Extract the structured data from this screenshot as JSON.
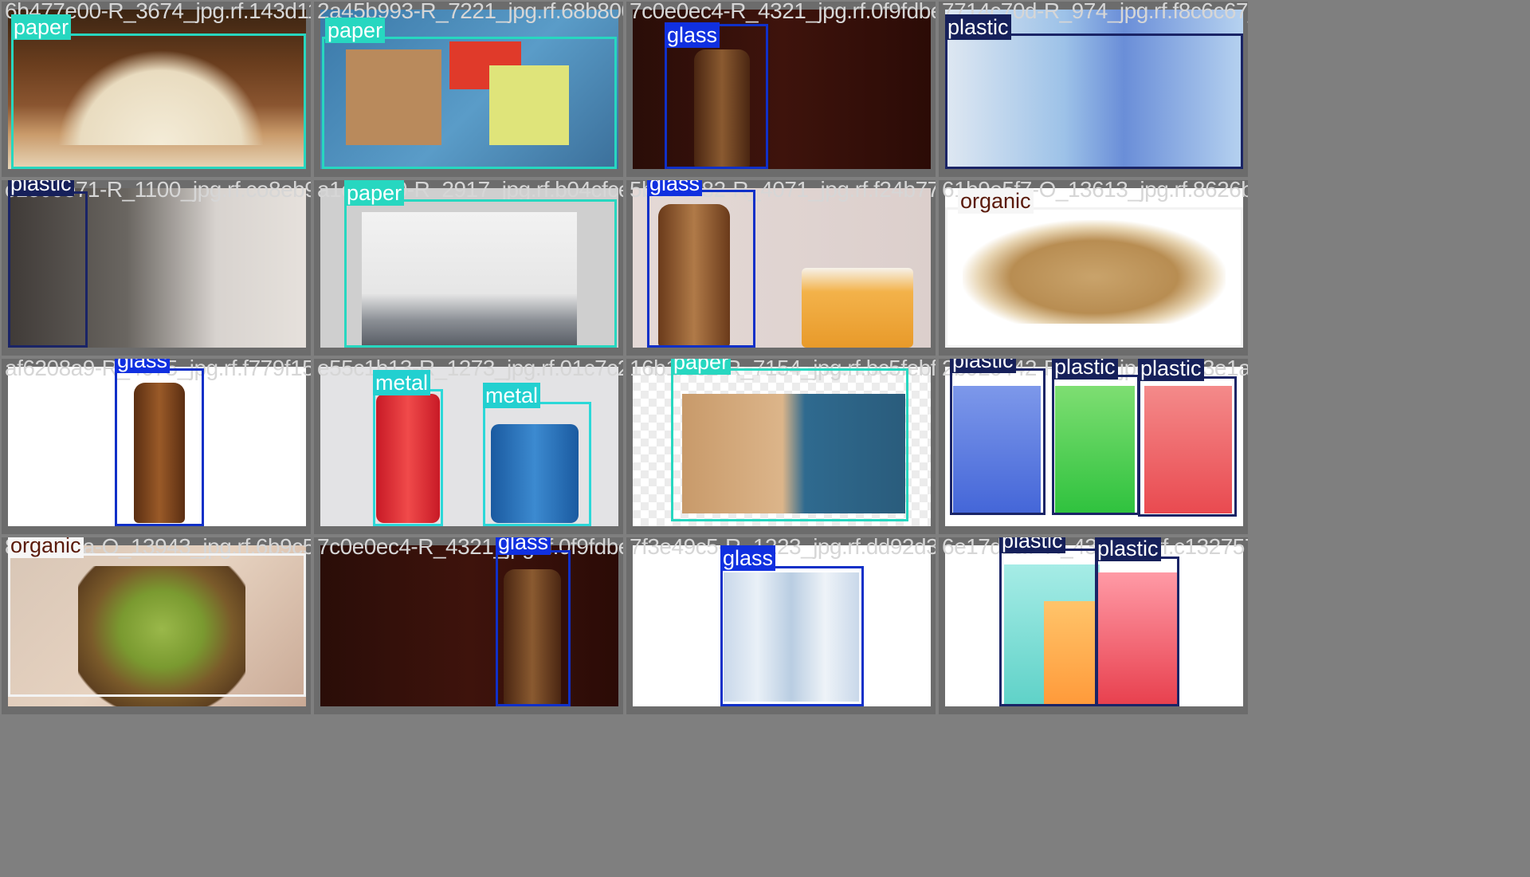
{
  "tiles": [
    {
      "filename": "6b477e00-R_3674_jpg.rf.143d112579c1a4fe0a9",
      "labels": [
        "paper"
      ]
    },
    {
      "filename": "2a45b993-R_7221_jpg.rf.68b80054a7d35a77",
      "labels": [
        "paper"
      ]
    },
    {
      "filename": "7c0e0ec4-R_4321_jpg.rf.0f9fdbe395bc",
      "labels": [
        "glass"
      ]
    },
    {
      "filename": "7714c70d-R_974_jpg.rf.f8c6c67_c7",
      "labels": [
        "plastic"
      ]
    },
    {
      "filename": "c1e09e71-R_1100_jpg.rf.co8eb9d5812c",
      "labels": [
        "plastic"
      ]
    },
    {
      "filename": "a1e9f4b0-R_2917_jpg.rf.b04cfced32ff",
      "labels": [
        "paper"
      ]
    },
    {
      "filename": "5b3d1a82-R_4071_jpg.rf.f24b7776996f",
      "labels": [
        "glass"
      ]
    },
    {
      "filename": "61b9e5f7-O_13613_jpg.rf.8626b075",
      "labels": [
        "organic"
      ]
    },
    {
      "filename": "af6208a9-R_4075_jpg.rf.f779f15933c056",
      "labels": [
        "glass"
      ]
    },
    {
      "filename": "e55c1b13-R_1273_jpg.rf.01c7c2fa19e13",
      "labels": [
        "metal",
        "metal"
      ]
    },
    {
      "filename": "16b1f3c2-R_7154_jpg.rf.bc5febfaed2bb",
      "labels": [
        "paper"
      ]
    },
    {
      "filename": "2b92c442-R_880_jpg.rf.f0a3e1a7d55",
      "labels": [
        "plastic",
        "plastic",
        "plastic"
      ]
    },
    {
      "filename": "8f1b393a-O_13943_jpg.rf.6b9c5efd8c35",
      "labels": [
        "organic"
      ]
    },
    {
      "filename": "7c0e0ec4-R_4321_jpg.rf.0f9fdbe395bc",
      "labels": [
        "glass"
      ]
    },
    {
      "filename": "7f3e49c5-R_1223_jpg.rf.dd92d39d3c7c",
      "labels": [
        "glass"
      ]
    },
    {
      "filename": "6e17d2a7-R_439_jpg.rf.c1327572",
      "labels": [
        "plastic",
        "plastic"
      ]
    }
  ]
}
